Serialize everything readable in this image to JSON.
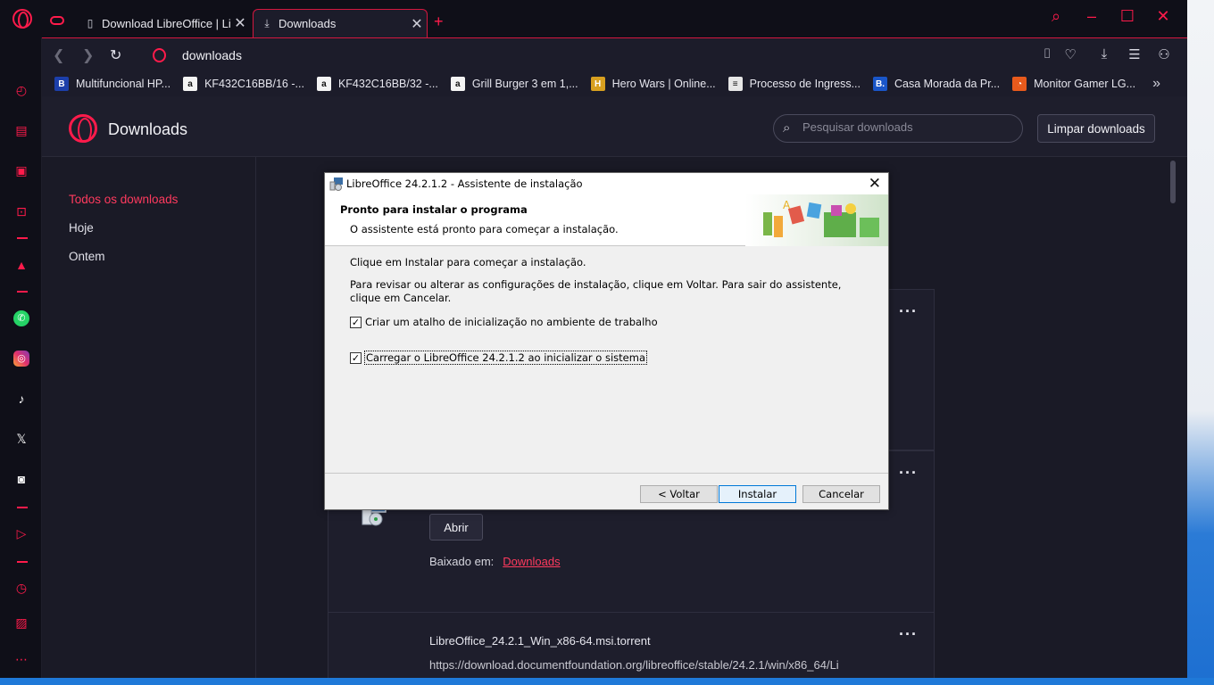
{
  "browser": {
    "tabs": [
      {
        "label": "Download LibreOffice | Libr",
        "icon": "page-icon"
      },
      {
        "label": "Downloads",
        "icon": "download-icon"
      }
    ],
    "address": {
      "url": "downloads"
    }
  },
  "bookmarks": [
    {
      "label": "Multifuncional HP...",
      "icon": "B",
      "color": "#1c3faa"
    },
    {
      "label": "KF432C16BB/16 -...",
      "icon": "a",
      "color": "#f4f4f4"
    },
    {
      "label": "KF432C16BB/32 -...",
      "icon": "a",
      "color": "#f4f4f4"
    },
    {
      "label": "Grill Burger 3 em 1,...",
      "icon": "a",
      "color": "#f4f4f4"
    },
    {
      "label": "Hero Wars | Online...",
      "icon": "H",
      "color": "#d8a020"
    },
    {
      "label": "Processo de Ingress...",
      "icon": "≡",
      "color": "#e6e6e6"
    },
    {
      "label": "Casa Morada da Pr...",
      "icon": "B.",
      "color": "#1a56c8"
    },
    {
      "label": "Monitor Gamer LG...",
      "icon": "◔",
      "color": "#e85a1c"
    }
  ],
  "downloads_page": {
    "title": "Downloads",
    "search_placeholder": "Pesquisar downloads",
    "clear_label": "Limpar downloads",
    "nav": [
      "Todos os downloads",
      "Hoje",
      "Ontem"
    ],
    "open_label": "Abrir",
    "saved_in_label": "Baixado em:",
    "saved_in_link": "Downloads",
    "next_file_name": "LibreOffice_24.2.1_Win_x86-64.msi.torrent",
    "next_file_url": "https://download.documentfoundation.org/libreoffice/stable/24.2.1/win/x86_64/Li"
  },
  "installer": {
    "title": "LibreOffice 24.2.1.2 - Assistente de instalação",
    "heading": "Pronto para instalar o programa",
    "subheading": "O assistente está pronto para começar a instalação.",
    "line1": "Clique em Instalar para começar a instalação.",
    "line2": "Para revisar ou alterar as configurações de instalação, clique em Voltar. Para sair do assistente, clique em Cancelar.",
    "checkbox1": "Criar um atalho de inicialização no ambiente de trabalho",
    "checkbox2": "Carregar o LibreOffice 24.2.1.2 ao inicializar o sistema",
    "checkbox1_checked": true,
    "checkbox2_checked": true,
    "back_label": "< Voltar",
    "install_label": "Instalar",
    "cancel_label": "Cancelar"
  }
}
